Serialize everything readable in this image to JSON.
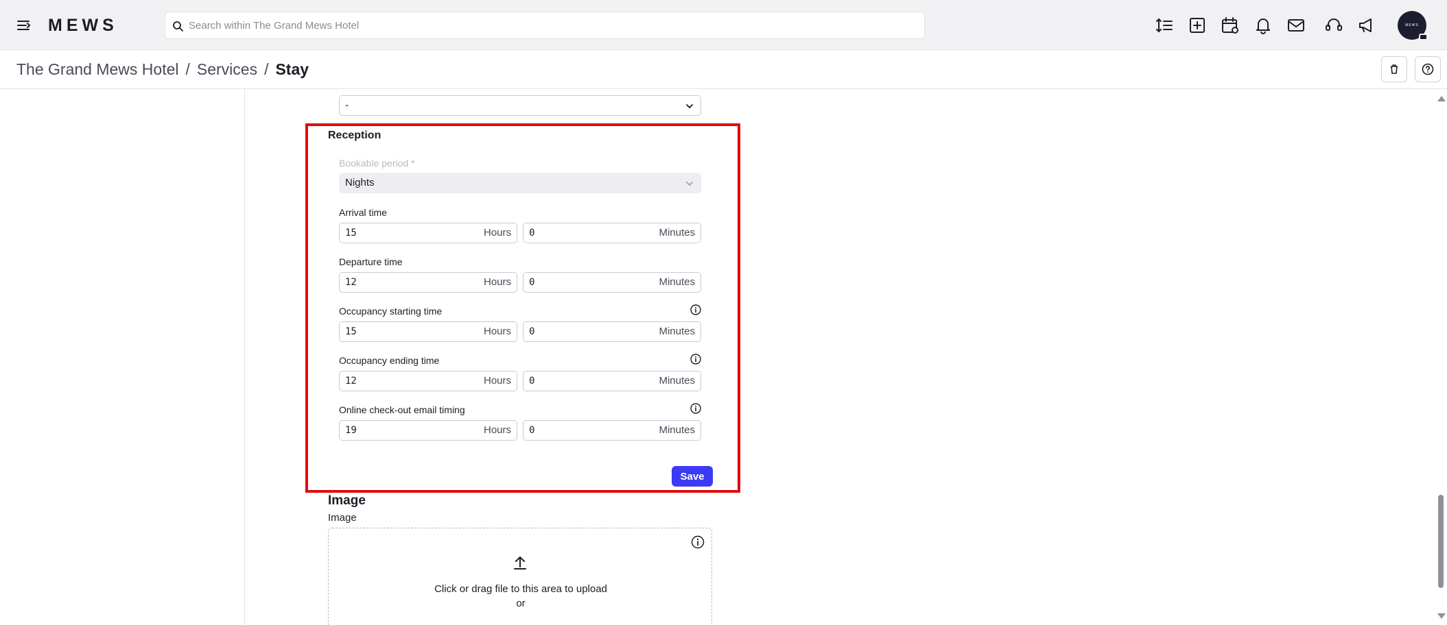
{
  "app": {
    "logo": "MEWS"
  },
  "search": {
    "placeholder": "Search within The Grand Mews Hotel"
  },
  "topbar_icons": [
    "line-height-icon",
    "add-icon",
    "calendar-icon",
    "bell-icon",
    "mail-icon",
    "support-icon",
    "megaphone-icon"
  ],
  "avatar": {
    "text": "MEWS"
  },
  "breadcrumb": {
    "items": [
      "The Grand Mews Hotel",
      "Services"
    ],
    "separator": "/",
    "current": "Stay"
  },
  "form": {
    "top_select_value": "-",
    "section_title": "Reception",
    "bookable_period": {
      "label": "Bookable period *",
      "value": "Nights"
    },
    "arrival_time": {
      "label": "Arrival time",
      "hours": "15",
      "minutes": "0"
    },
    "departure_time": {
      "label": "Departure time",
      "hours": "12",
      "minutes": "0"
    },
    "occupancy_start": {
      "label": "Occupancy starting time",
      "hours": "15",
      "minutes": "0"
    },
    "occupancy_end": {
      "label": "Occupancy ending time",
      "hours": "12",
      "minutes": "0"
    },
    "checkout_email": {
      "label": "Online check-out email timing",
      "hours": "19",
      "minutes": "0"
    },
    "units": {
      "hours": "Hours",
      "minutes": "Minutes"
    },
    "save_label": "Save"
  },
  "image_section": {
    "title": "Image",
    "field_label": "Image",
    "dropzone_text": "Click or drag file to this area to upload",
    "or_text": "or"
  },
  "colors": {
    "accent": "#3b3bf5",
    "highlight": "#e20c0c",
    "topbar_bg": "#f1f1f3"
  }
}
